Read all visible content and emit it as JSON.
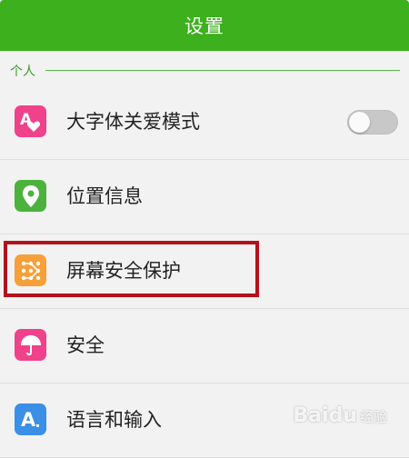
{
  "header": {
    "title": "设置"
  },
  "section": {
    "label": "个人"
  },
  "items": [
    {
      "label": "大字体关爱模式",
      "icon": "large-font-heart-icon",
      "color": "#f0428a",
      "toggle": false
    },
    {
      "label": "位置信息",
      "icon": "location-pin-icon",
      "color": "#4cb23d"
    },
    {
      "label": "屏幕安全保护",
      "icon": "pattern-lock-icon",
      "color": "#f5a03a"
    },
    {
      "label": "安全",
      "icon": "umbrella-icon",
      "color": "#f0428a"
    },
    {
      "label": "语言和输入",
      "icon": "language-a-icon",
      "color": "#3b8fe6"
    }
  ],
  "watermark": {
    "text": "Bai",
    "text2": "du",
    "sub": "经验"
  }
}
